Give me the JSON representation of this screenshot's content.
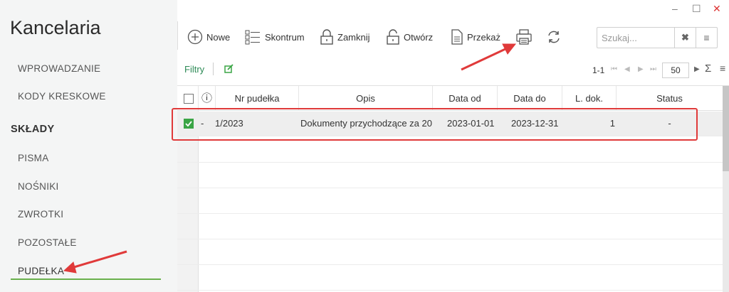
{
  "window": {
    "minimize": "–",
    "maximize": "☐",
    "close": "✕"
  },
  "app": {
    "title": "Kancelaria"
  },
  "sidebar": {
    "items_top": [
      {
        "label": "WPROWADZANIE"
      },
      {
        "label": "KODY KRESKOWE"
      }
    ],
    "section": "SKŁADY",
    "items": [
      {
        "label": "PISMA"
      },
      {
        "label": "NOŚNIKI"
      },
      {
        "label": "ZWROTKI"
      },
      {
        "label": "POZOSTAŁE"
      },
      {
        "label": "PUDEŁKA",
        "active": true
      }
    ]
  },
  "toolbar": {
    "new_label": "Nowe",
    "skontrum_label": "Skontrum",
    "close_label": "Zamknij",
    "open_label": "Otwórz",
    "transfer_label": "Przekaż",
    "print_icon": "printer-icon",
    "refresh_icon": "refresh-icon"
  },
  "search": {
    "placeholder": "Szukaj...",
    "value": "",
    "clear": "✖",
    "menu": "≡"
  },
  "filters": {
    "label": "Filtry"
  },
  "pager": {
    "range": "1-1",
    "page_size": "50",
    "sum": "Σ",
    "menu": "≡"
  },
  "grid": {
    "headers": {
      "info": "ⓘ",
      "nr": "Nr pudełka",
      "opis": "Opis",
      "data_od": "Data od",
      "data_do": "Data do",
      "l_dok": "L. dok.",
      "status": "Status"
    },
    "rows": [
      {
        "selected": true,
        "info": "-",
        "nr": "1/2023",
        "opis": "Dokumenty przychodzące za 20",
        "data_od": "2023-01-01",
        "data_do": "2023-12-31",
        "l_dok": "1",
        "status": "-"
      }
    ]
  },
  "colors": {
    "accent_green": "#3aa545",
    "link_green": "#2e8b57",
    "annotation_red": "#e03a3a",
    "active_underline": "#6ab04c"
  }
}
